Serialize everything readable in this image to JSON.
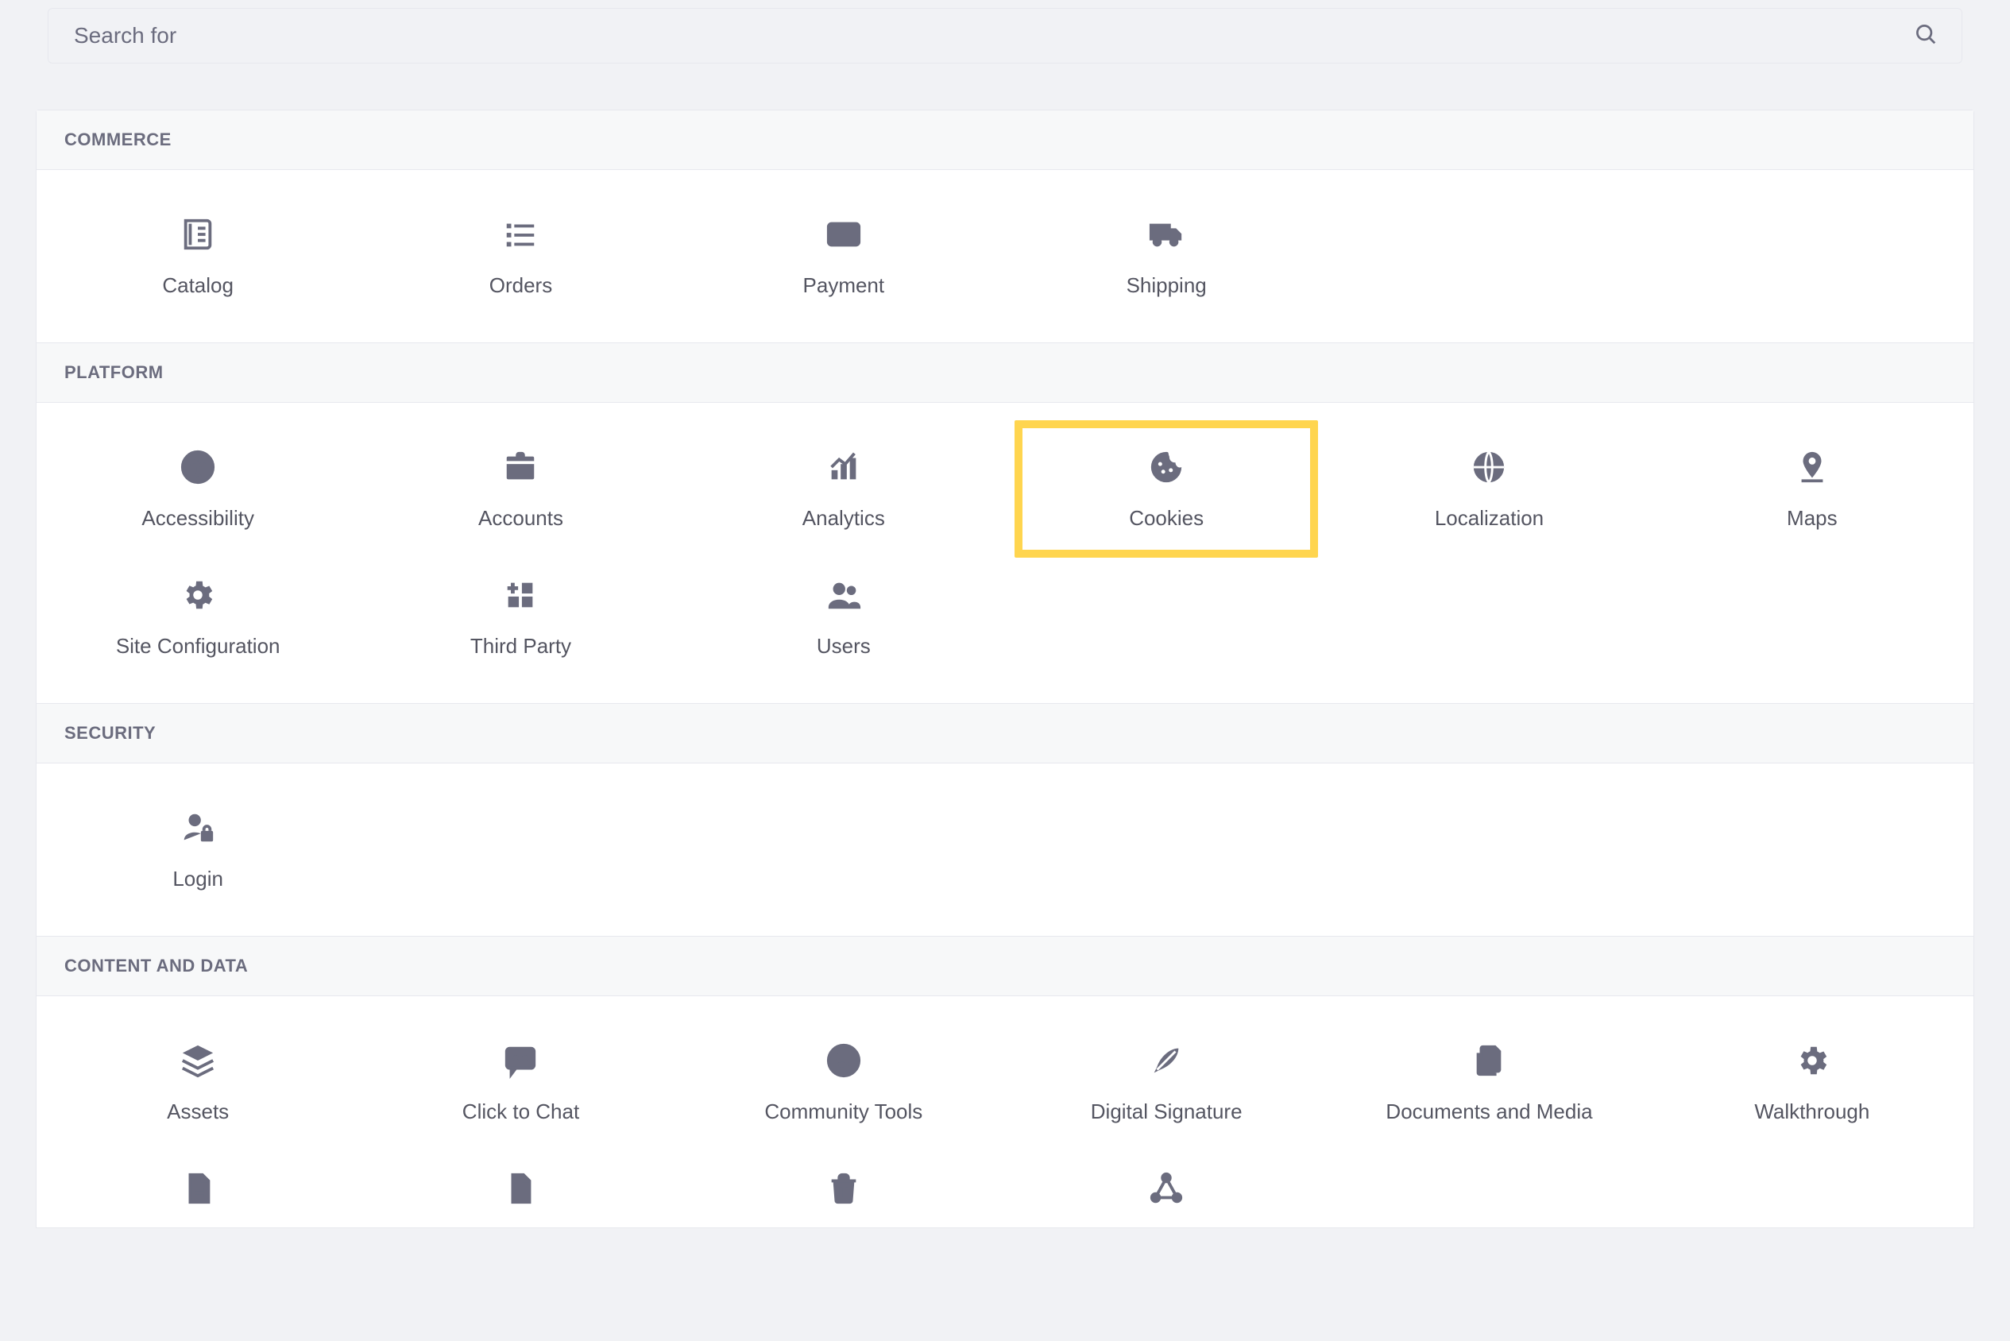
{
  "search": {
    "placeholder": "Search for"
  },
  "sections": {
    "commerce": {
      "title": "COMMERCE",
      "items": {
        "catalog": {
          "label": "Catalog"
        },
        "orders": {
          "label": "Orders"
        },
        "payment": {
          "label": "Payment"
        },
        "shipping": {
          "label": "Shipping"
        }
      }
    },
    "platform": {
      "title": "PLATFORM",
      "items": {
        "accessibility": {
          "label": "Accessibility"
        },
        "accounts": {
          "label": "Accounts"
        },
        "analytics": {
          "label": "Analytics"
        },
        "cookies": {
          "label": "Cookies"
        },
        "localization": {
          "label": "Localization"
        },
        "maps": {
          "label": "Maps"
        },
        "siteconfig": {
          "label": "Site Configuration"
        },
        "thirdparty": {
          "label": "Third Party"
        },
        "users": {
          "label": "Users"
        }
      }
    },
    "security": {
      "title": "SECURITY",
      "items": {
        "login": {
          "label": "Login"
        }
      }
    },
    "content": {
      "title": "CONTENT AND DATA",
      "items": {
        "assets": {
          "label": "Assets"
        },
        "clicktochat": {
          "label": "Click to Chat"
        },
        "communitytools": {
          "label": "Community Tools"
        },
        "digitalsig": {
          "label": "Digital Signature"
        },
        "docsmedia": {
          "label": "Documents and Media"
        },
        "walkthrough": {
          "label": "Walkthrough"
        }
      }
    }
  }
}
